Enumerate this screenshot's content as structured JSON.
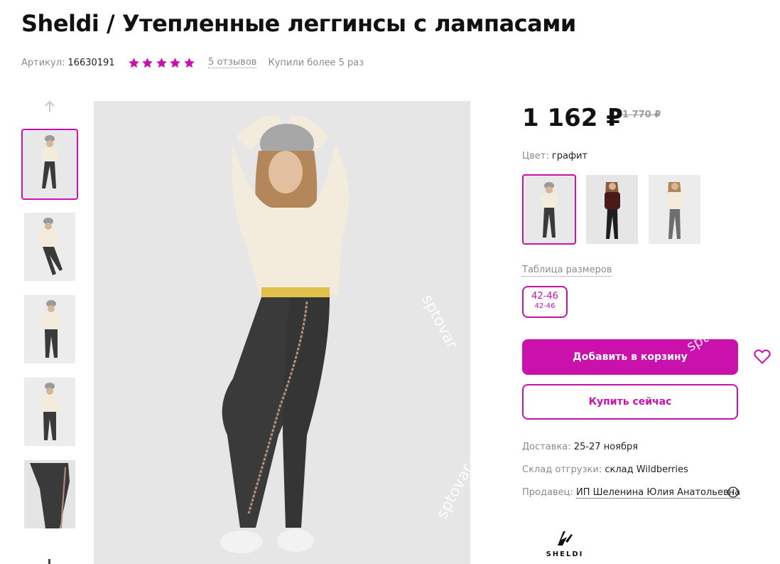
{
  "product": {
    "title": "Sheldi / Утепленные леггинсы с лампасами",
    "article_label": "Артикул:",
    "article_value": "16630191",
    "rating_stars": 5,
    "reviews_label": "5 отзывов",
    "bought_label": "Купили более 5 раз"
  },
  "price": {
    "current": "1 162 ₽",
    "old": "1 770 ₽"
  },
  "color": {
    "label": "Цвет:",
    "value": "графит"
  },
  "sizes": {
    "table_label": "Таблица размеров",
    "selected_size": "42-46",
    "selected_size_ru": "42-46"
  },
  "actions": {
    "add_to_cart": "Добавить в корзину",
    "buy_now": "Купить сейчас"
  },
  "info": {
    "delivery_label": "Доставка:",
    "delivery_value": "25-27 ноября",
    "warehouse_label": "Склад отгрузки:",
    "warehouse_value": "склад Wildberries",
    "seller_label": "Продавец:",
    "seller_value": "ИП Шеленина Юлия Анатольевна"
  },
  "watermarks": [
    "sptovar",
    "sptovar",
    "sptovar"
  ],
  "brand": {
    "name": "SHELDI"
  },
  "colors": {
    "accent": "#cb11ab",
    "muted": "#8b8b8b",
    "leggings": "#3a3a3a",
    "sweater": "#f3ecdd"
  },
  "icons": {
    "up": "arrow-up-icon",
    "star": "star-icon",
    "heart": "heart-icon",
    "info": "info-icon"
  }
}
